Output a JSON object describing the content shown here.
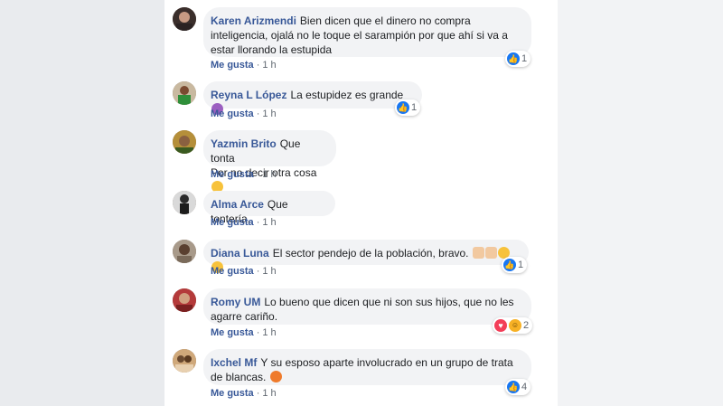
{
  "meta": {
    "like_label": "Me gusta",
    "separator": "·"
  },
  "comments": [
    {
      "author": "Karen Arizmendi",
      "text": "Bien dicen que el dinero no compra inteligencia, ojalá no le toque el sarampión por que ahí si va a estar llorando la estupida",
      "time": "1 h",
      "reactions": [
        "like"
      ],
      "reaction_count": "1"
    },
    {
      "author": "Reyna L López",
      "text": "La estupidez es grande",
      "emoji": [
        "purple-face"
      ],
      "time": "1 h",
      "reactions": [
        "like"
      ],
      "reaction_count": "1"
    },
    {
      "author": "Yazmin Brito",
      "text": "Que tonta",
      "text2": "Por no decir otra cosa",
      "emoji": [
        "disappointed-face"
      ],
      "time": "1 h"
    },
    {
      "author": "Alma Arce",
      "text": "Que tontería.",
      "time": "1 h"
    },
    {
      "author": "Diana Luna",
      "text": "El sector pendejo de la población, bravo.",
      "emoji": [
        "clapping-hands",
        "clapping-hands",
        "eye-roll-face",
        "disappointed-face"
      ],
      "time": "1 h",
      "reactions": [
        "like"
      ],
      "reaction_count": "1"
    },
    {
      "author": "Romy UM",
      "text": "Lo bueno que dicen que ni son sus hijos, que no les agarre cariño.",
      "time": "1 h",
      "reactions": [
        "love",
        "haha"
      ],
      "reaction_count": "2"
    },
    {
      "author": "Ixchel Mf",
      "text": "Y su esposo aparte involucrado en un grupo de trata de blancas.",
      "emoji": [
        "angry-face"
      ],
      "time": "1 h",
      "reactions": [
        "like"
      ],
      "reaction_count": "4"
    }
  ],
  "colors": {
    "author": "#385898",
    "bubble": "#f2f3f5",
    "like_reaction": "#1877f2",
    "love_reaction": "#f33e58"
  }
}
